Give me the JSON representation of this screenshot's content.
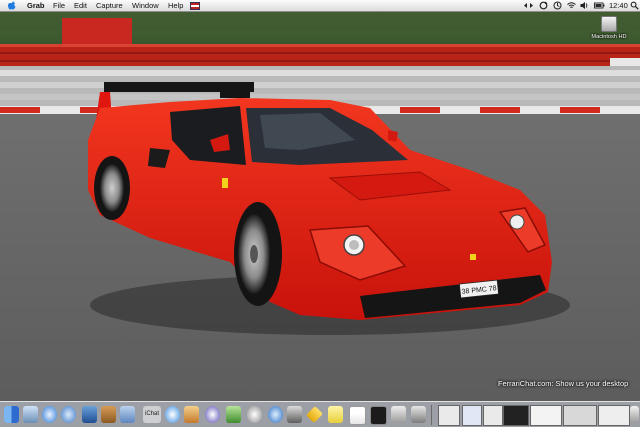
{
  "menubar": {
    "app_name": "Grab",
    "menus": [
      "File",
      "Edit",
      "Capture",
      "Window",
      "Help"
    ],
    "clock": "12:40",
    "icons": [
      "apple-icon",
      "flag-icon",
      "arrows-icon",
      "sync-icon",
      "timer-icon",
      "wifi-icon",
      "volume-icon",
      "battery-icon",
      "spotlight-icon"
    ]
  },
  "desktop": {
    "drive_label": "Macintosh HD"
  },
  "caption": "FerrariChat.com: Show us your desktop",
  "car": {
    "plate": "38 PMC 78"
  },
  "dock": {
    "chat_label": "iChat",
    "apps": [
      "finder-icon",
      "preview-icon",
      "safari-icon",
      "mail-icon",
      "address-icon",
      "sherlock-icon",
      "ichat-icon",
      "itunes-icon",
      "iphoto-icon",
      "imovie-icon",
      "iworks-icon",
      "system-prefs-icon",
      "calendar-icon",
      "terminal-icon",
      "grab-icon",
      "trash-icon"
    ],
    "colors": {
      "accent": "#2b6fd3",
      "car_red": "#e0160f"
    }
  }
}
